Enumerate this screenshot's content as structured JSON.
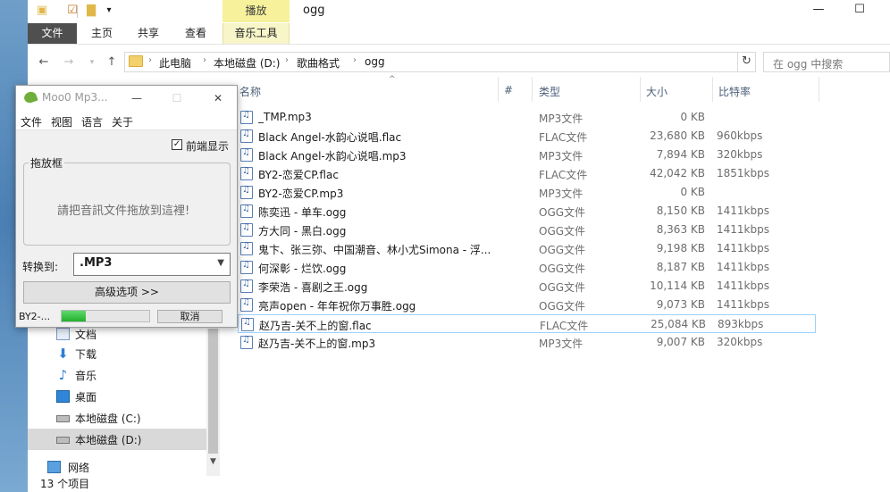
{
  "explorer": {
    "title": "ogg",
    "contextual_tab": "播放",
    "ribbon_tabs": [
      "文件",
      "主页",
      "共享",
      "查看",
      "音乐工具"
    ],
    "path": [
      "此电脑",
      "本地磁盘 (D:)",
      "歌曲格式",
      "ogg"
    ],
    "search_placeholder": "在 ogg 中搜索",
    "columns": [
      "名称",
      "#",
      "类型",
      "大小",
      "比特率"
    ],
    "files": [
      {
        "name": "_TMP.mp3",
        "type": "MP3文件",
        "size": "0 KB",
        "bitrate": ""
      },
      {
        "name": "Black Angel-水韵心说唱.flac",
        "type": "FLAC文件",
        "size": "23,680 KB",
        "bitrate": "960kbps"
      },
      {
        "name": "Black Angel-水韵心说唱.mp3",
        "type": "MP3文件",
        "size": "7,894 KB",
        "bitrate": "320kbps"
      },
      {
        "name": "BY2-恋爱CP.flac",
        "type": "FLAC文件",
        "size": "42,042 KB",
        "bitrate": "1851kbps"
      },
      {
        "name": "BY2-恋爱CP.mp3",
        "type": "MP3文件",
        "size": "0 KB",
        "bitrate": ""
      },
      {
        "name": "陈奕迅 - 单车.ogg",
        "type": "OGG文件",
        "size": "8,150 KB",
        "bitrate": "1411kbps"
      },
      {
        "name": "方大同 - 黑白.ogg",
        "type": "OGG文件",
        "size": "8,363 KB",
        "bitrate": "1411kbps"
      },
      {
        "name": "鬼卞、张三弥、中国潮音、林小尤Simona - 浮...",
        "type": "OGG文件",
        "size": "9,198 KB",
        "bitrate": "1411kbps"
      },
      {
        "name": "何深彰 - 烂饮.ogg",
        "type": "OGG文件",
        "size": "8,187 KB",
        "bitrate": "1411kbps"
      },
      {
        "name": "李荣浩 - 喜剧之王.ogg",
        "type": "OGG文件",
        "size": "10,114 KB",
        "bitrate": "1411kbps"
      },
      {
        "name": "亮声open - 年年祝你万事胜.ogg",
        "type": "OGG文件",
        "size": "9,073 KB",
        "bitrate": "1411kbps"
      },
      {
        "name": "赵乃吉-关不上的窗.flac",
        "type": "FLAC文件",
        "size": "25,084 KB",
        "bitrate": "893kbps"
      },
      {
        "name": "赵乃吉-关不上的窗.mp3",
        "type": "MP3文件",
        "size": "9,007 KB",
        "bitrate": "320kbps"
      }
    ],
    "nav_items": [
      "文档",
      "下载",
      "音乐",
      "桌面",
      "本地磁盘 (C:)",
      "本地磁盘 (D:)",
      "网络"
    ],
    "status": "13 个项目"
  },
  "moo": {
    "title": "Moo0 Mp3...",
    "menu": [
      "文件",
      "视图",
      "语言",
      "关于"
    ],
    "always_on_top": "前端显示",
    "drop_title": "拖放框",
    "drop_hint": "請把音訊文件拖放到這裡!",
    "convert_label": "转换到:",
    "format": ".MP3",
    "advanced": "高级选项 >>",
    "current_file": "BY2-...",
    "progress": 0.28,
    "cancel": "取消"
  },
  "colors": {
    "ribbon_file": "#4f4f4f",
    "contextual": "#f6f19a",
    "progress": "#23b02f",
    "selection": "#99d1ff"
  }
}
